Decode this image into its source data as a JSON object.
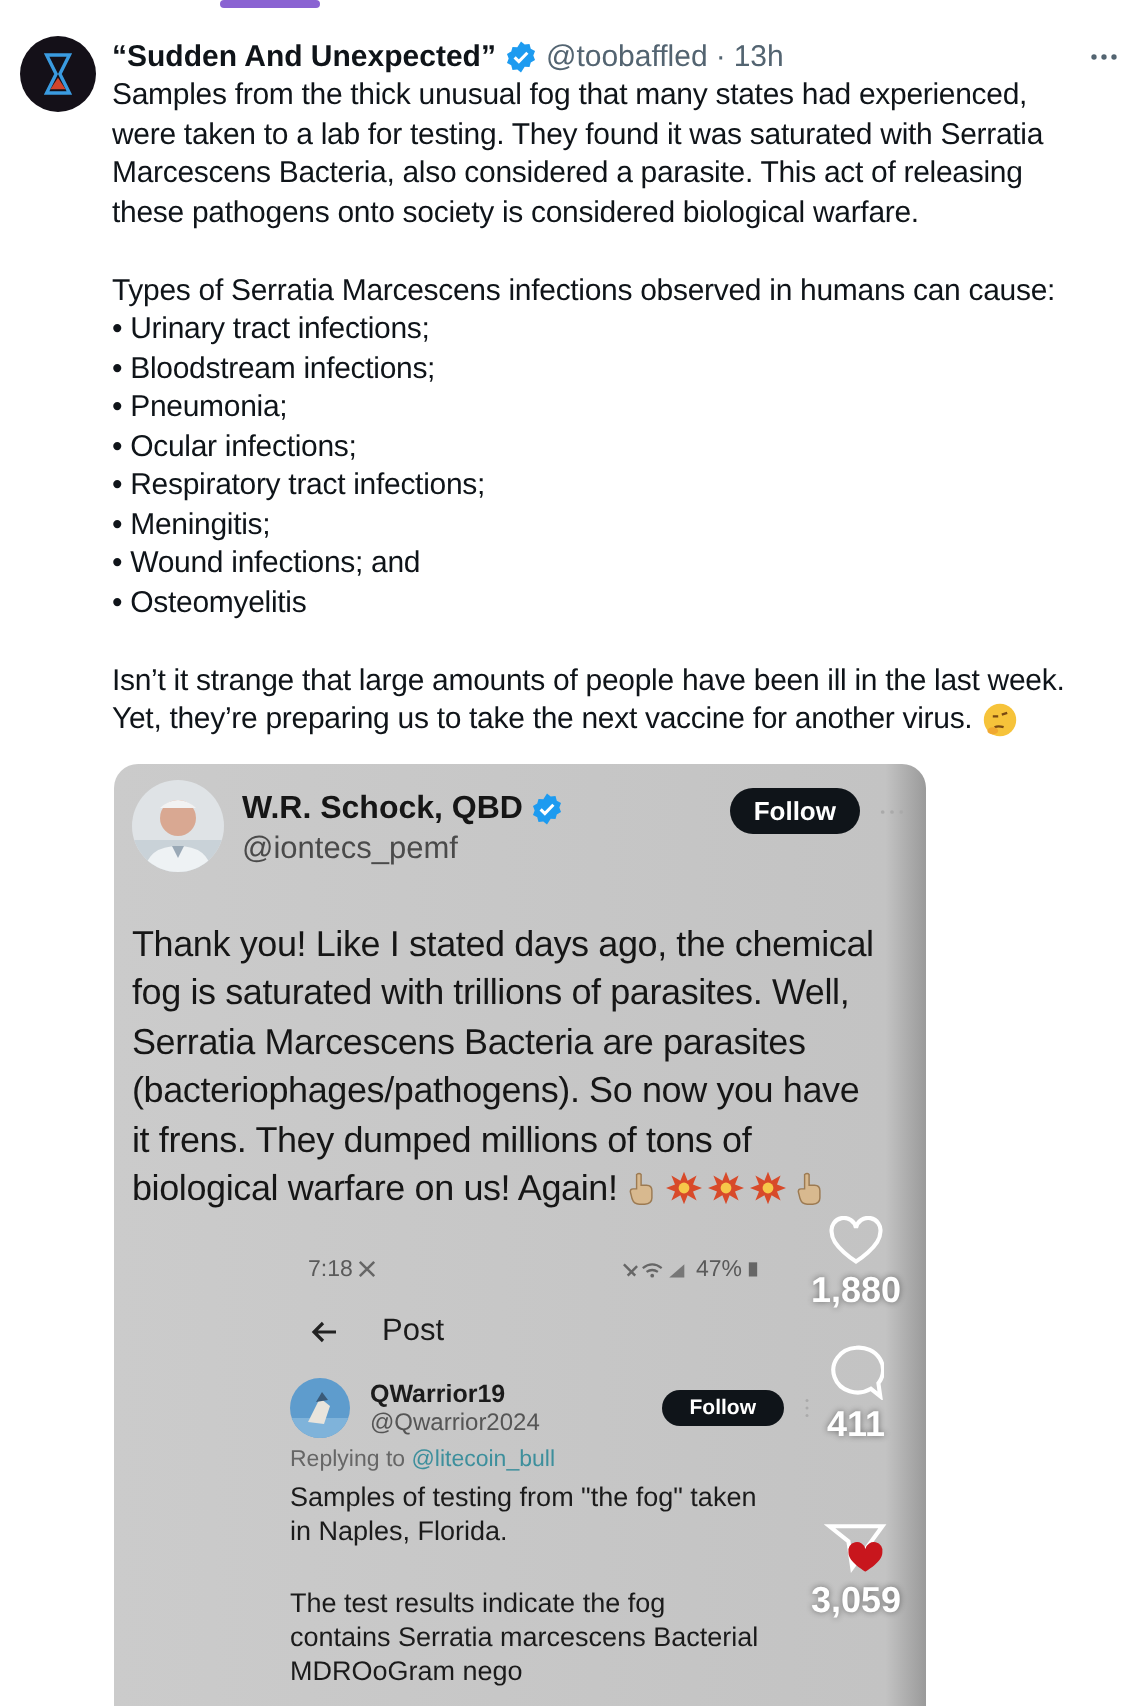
{
  "post": {
    "author_name": "“Sudden And Unexpected”",
    "verified": true,
    "handle": "@toobaffled",
    "separator": "·",
    "time": "13h",
    "intro_paragraph": "Samples from the thick unusual fog that many states had experienced, were taken to a lab for testing.  They found it was saturated with Serratia Marcescens Bacteria, also considered a parasite. This act of releasing these pathogens onto society is considered biological warfare.",
    "list_heading": "Types of Serratia Marcescens infections observed in humans can cause:",
    "bullets": [
      "• Urinary tract infections;",
      "• Bloodstream infections;",
      "• Pneumonia;",
      "• Ocular infections;",
      "• Respiratory tract infections;",
      "• Meningitis;",
      "• Wound infections; and",
      "• Osteomyelitis"
    ],
    "closing_sentences": [
      "Isn’t it strange that large amounts of people have been ill in the last week.",
      "Yet, they’re preparing us to take the next vaccine for another virus."
    ]
  },
  "media": {
    "quoted": {
      "name": "W.R. Schock, QBD",
      "verified": true,
      "handle": "@iontecs_pemf",
      "follow_label": "Follow",
      "text": "Thank you! Like I stated days ago, the chemical\nfog is saturated with trillions of parasites. Well,\nSerratia Marcescens Bacteria are parasites\n(bacteriophages/pathogens). So now you have\nit frens. They dumped millions of tons of",
      "last_line": "biological warfare on us! Again!"
    },
    "phone": {
      "time": "7:18",
      "battery": "47%",
      "title": "Post",
      "reply": {
        "name": "QWarrior19",
        "handle": "@Qwarrior2024",
        "follow_label": "Follow",
        "replying_prefix": "Replying to",
        "replying_to": "@litecoin_bull",
        "paragraphs": [
          "Samples of testing from \"the fog\" taken in Naples, Florida.",
          "The test results indicate the fog contains Serratia marcescens Bacterial MDROoGram nego"
        ]
      }
    },
    "actions": [
      {
        "kind": "like",
        "count": "1,880"
      },
      {
        "kind": "comment",
        "count": "411"
      },
      {
        "kind": "share",
        "count": "3,059"
      }
    ]
  }
}
